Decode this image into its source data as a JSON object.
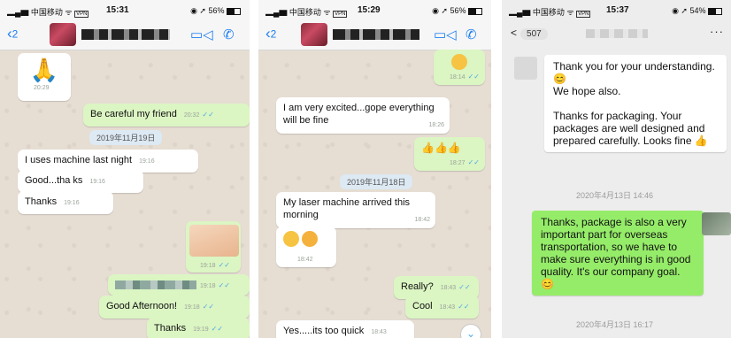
{
  "panel1": {
    "status": {
      "carrier": "中国移动",
      "vpn": "VPN",
      "time": "15:31",
      "battery": "56%"
    },
    "header": {
      "back_count": "2"
    },
    "messages": [
      {
        "kind": "emoji",
        "direction": "in",
        "time": "20:29"
      },
      {
        "kind": "text",
        "direction": "out",
        "text": "Be careful my friend",
        "time": "20:32"
      },
      {
        "kind": "date",
        "text": "2019年11月19日"
      },
      {
        "kind": "text",
        "direction": "in",
        "text": "I uses machine last night",
        "time": "19:16"
      },
      {
        "kind": "text",
        "direction": "in",
        "text": "Good...tha ks",
        "time": "19:16"
      },
      {
        "kind": "text",
        "direction": "in",
        "text": "Thanks",
        "time": "19:16"
      },
      {
        "kind": "image",
        "direction": "out",
        "time": "19:18"
      },
      {
        "kind": "blurred",
        "direction": "out",
        "time": "19:18"
      },
      {
        "kind": "text",
        "direction": "out",
        "text": "Good Afternoon!",
        "time": "19:18"
      },
      {
        "kind": "text",
        "direction": "out",
        "text": "Thanks",
        "time": "19:19"
      }
    ]
  },
  "panel2": {
    "status": {
      "carrier": "中国移动",
      "vpn": "VPN",
      "time": "15:29",
      "battery": "56%"
    },
    "header": {
      "back_count": "2"
    },
    "messages": [
      {
        "kind": "emoji",
        "direction": "out",
        "time": "18:14"
      },
      {
        "kind": "text",
        "direction": "in",
        "text": "I am very excited...gope everything will be fine",
        "time": "18:26"
      },
      {
        "kind": "emoji",
        "direction": "out",
        "time": "18:27"
      },
      {
        "kind": "date",
        "text": "2019年11月18日"
      },
      {
        "kind": "text",
        "direction": "in",
        "text": "My laser machine arrived this morning",
        "time": "18:42"
      },
      {
        "kind": "emoji",
        "direction": "in",
        "time": "18:42"
      },
      {
        "kind": "text",
        "direction": "out",
        "text": "Really?",
        "time": "18:43"
      },
      {
        "kind": "text",
        "direction": "out",
        "text": "Cool",
        "time": "18:43"
      },
      {
        "kind": "text",
        "direction": "in",
        "text": "Yes.....its too quick",
        "time": "18:43"
      }
    ]
  },
  "panel3": {
    "status": {
      "carrier": "中国移动",
      "vpn": "VPN",
      "time": "15:37",
      "battery": "54%"
    },
    "header": {
      "back_label": "<",
      "unread_count": "507"
    },
    "messages": [
      {
        "direction": "in",
        "lines": [
          "Thank you for your understanding. 😊",
          "We hope also.",
          "",
          "Thanks for packaging. Your packages are well designed and prepared carefully. Looks fine 👍"
        ]
      },
      {
        "kind": "time",
        "text": "2020年4月13日 14:46"
      },
      {
        "direction": "out",
        "text": "Thanks, package is also a very important part for overseas transportation, so we have to make sure everything is in good quality. It's our company goal. 😊"
      },
      {
        "kind": "time",
        "text": "2020年4月13日 16:17"
      }
    ]
  }
}
